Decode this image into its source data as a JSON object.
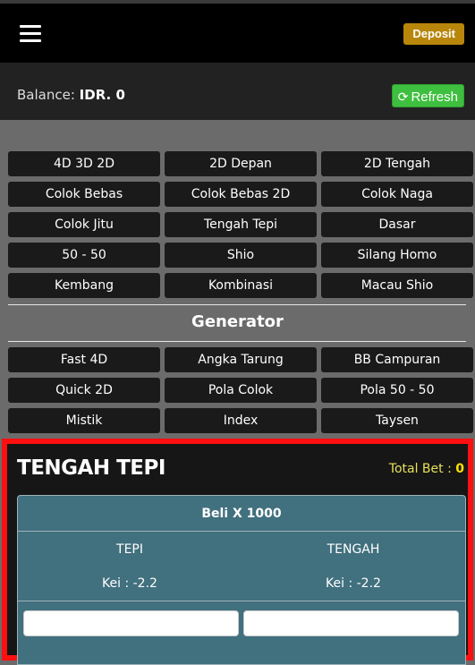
{
  "header": {
    "deposit_label": "Deposit"
  },
  "balance": {
    "label": "Balance:",
    "value": "IDR. 0",
    "refresh_label": "Refresh"
  },
  "games": [
    "4D 3D 2D",
    "2D Depan",
    "2D Tengah",
    "Colok Bebas",
    "Colok Bebas 2D",
    "Colok Naga",
    "Colok Jitu",
    "Tengah Tepi",
    "Dasar",
    "50 - 50",
    "Shio",
    "Silang Homo",
    "Kembang",
    "Kombinasi",
    "Macau Shio"
  ],
  "generator": {
    "title": "Generator",
    "items": [
      "Fast 4D",
      "Angka Tarung",
      "BB Campuran",
      "Quick 2D",
      "Pola Colok",
      "Pola 50 - 50",
      "Mistik",
      "Index",
      "Taysen"
    ]
  },
  "bet_panel": {
    "title": "TENGAH TEPI",
    "total_bet_label": "Total Bet :",
    "total_bet_value": "0",
    "multiplier_label": "Beli X 1000",
    "columns": [
      {
        "name": "TEPI",
        "kei": "Kei : -2.2"
      },
      {
        "name": "TENGAH",
        "kei": "Kei : -2.2"
      }
    ]
  },
  "colors": {
    "deposit": "#b8860b",
    "refresh": "#3fbf3f",
    "highlight": "#ff1010",
    "card": "#41707e",
    "total_bet": "#ffe100"
  }
}
